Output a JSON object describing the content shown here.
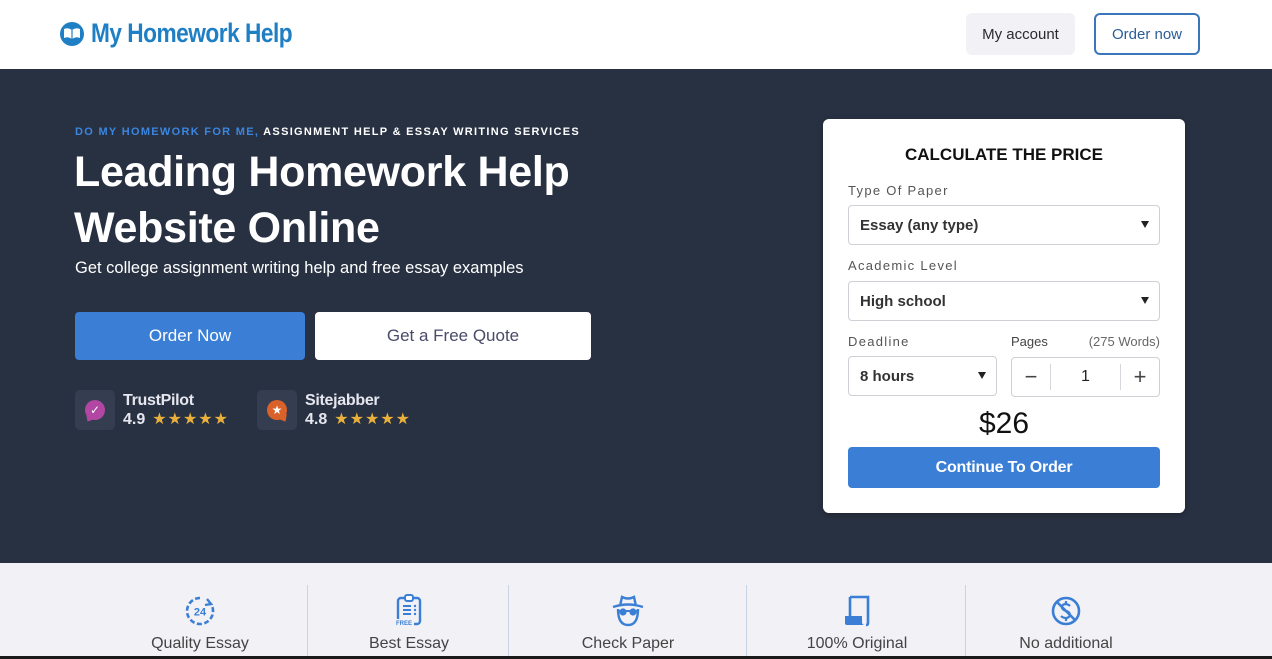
{
  "header": {
    "logo_text": "My Homework Help",
    "my_account_label": "My account",
    "order_now_label": "Order now"
  },
  "hero": {
    "eyebrow_accent": "DO MY HOMEWORK FOR ME,",
    "eyebrow_rest": " ASSIGNMENT HELP & ESSAY WRITING SERVICES",
    "headline_line1": "Leading Homework Help",
    "headline_line2": "Website Online",
    "subline": "Get college assignment writing help and free essay examples",
    "order_button": "Order Now",
    "quote_button": "Get a Free Quote",
    "ratings": [
      {
        "name": "TrustPilot",
        "score": "4.9",
        "stars": 5,
        "icon": "trustpilot-check-icon",
        "color": "#b246a3"
      },
      {
        "name": "Sitejabber",
        "score": "4.8",
        "stars": 5,
        "icon": "sitejabber-star-icon",
        "color": "#d9622a"
      }
    ]
  },
  "calculator": {
    "title": "CALCULATE THE PRICE",
    "type_label": "Type Of Paper",
    "type_value": "Essay (any type)",
    "level_label": "Academic Level",
    "level_value": "High school",
    "deadline_label": "Deadline",
    "deadline_value": "8 hours",
    "pages_label": "Pages",
    "words_label": "(275 Words)",
    "pages_value": "1",
    "minus": "−",
    "plus": "+",
    "price": "$26",
    "continue_label": "Continue To Order"
  },
  "features": [
    {
      "label": "Quality Essay",
      "icon": "24-hours-icon"
    },
    {
      "label": "Best Essay",
      "icon": "free-clipboard-icon"
    },
    {
      "label": "Check Paper",
      "icon": "spy-icon"
    },
    {
      "label": "100% Original",
      "icon": "paper-scroll-icon"
    },
    {
      "label": "No additional",
      "icon": "no-dollar-icon"
    }
  ],
  "colors": {
    "brand": "#1f7fc4",
    "accent": "#3a7fd5",
    "hero_bg": "#283142",
    "star": "#e9b13c"
  }
}
